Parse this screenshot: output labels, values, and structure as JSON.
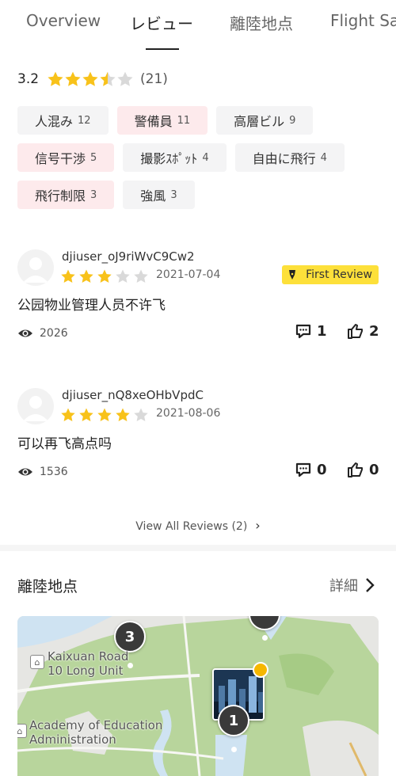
{
  "tabs": [
    {
      "label": "Overview"
    },
    {
      "label": "レビュー"
    },
    {
      "label": "離陸地点"
    },
    {
      "label": "Flight Sa"
    }
  ],
  "rating": {
    "score": "3.2",
    "stars": 3.5,
    "count": "(21)"
  },
  "tags": [
    {
      "label": "人混み",
      "count": "12",
      "negative": false
    },
    {
      "label": "警備員",
      "count": "11",
      "negative": true
    },
    {
      "label": "高層ビル",
      "count": "9",
      "negative": false
    },
    {
      "label": "信号干渉",
      "count": "5",
      "negative": true
    },
    {
      "label": "撮影ｽﾎﾟｯﾄ",
      "count": "4",
      "negative": false
    },
    {
      "label": "自由に飛行",
      "count": "4",
      "negative": false
    },
    {
      "label": "飛行制限",
      "count": "3",
      "negative": true
    },
    {
      "label": "強風",
      "count": "3",
      "negative": false
    }
  ],
  "reviews": [
    {
      "username": "djiuser_oJ9riWvC9Cw2",
      "stars": 3,
      "date": "2021-07-04",
      "badge": "First Review",
      "text": "公园物业管理人员不许飞",
      "views": "2026",
      "comments": "1",
      "likes": "2"
    },
    {
      "username": "djiuser_nQ8xeOHbVpdC",
      "stars": 4,
      "date": "2021-08-06",
      "badge": "",
      "text": "可以再飞高点吗",
      "views": "1536",
      "comments": "0",
      "likes": "0"
    }
  ],
  "view_all": "View All Reviews (2)",
  "takeoff": {
    "title": "離陸地点",
    "more": "詳細"
  },
  "map": {
    "labels": [
      {
        "text": "Kaixuan Road 10 Long Unit"
      },
      {
        "text": "Academy of Education Administration"
      }
    ],
    "clusters": [
      "3",
      "1"
    ]
  },
  "colors": {
    "star": "#f8c21a",
    "star_empty": "#d9d9d9",
    "badge": "#fde03a",
    "negative_tag": "#fdeaec"
  }
}
